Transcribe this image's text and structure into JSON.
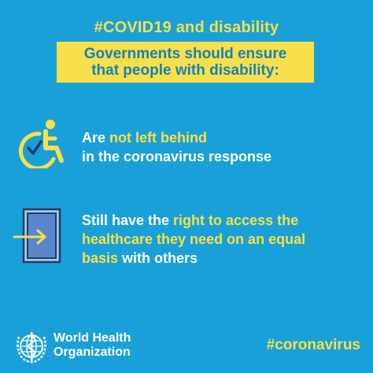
{
  "header": {
    "hashtag": "#COVID19 and disability",
    "banner_line1": "Governments should ensure",
    "banner_line2": "that people with disability:"
  },
  "items": [
    {
      "icon": "wheelchair-check-icon",
      "pre": "Are ",
      "highlight": "not left behind",
      "line2": "in the coronavirus response"
    },
    {
      "icon": "door-arrow-icon",
      "pre": "Still have the ",
      "highlight1": "right to access the",
      "highlight2": "healthcare they need on an equal",
      "highlight3": "basis",
      "post": " with others"
    }
  ],
  "footer": {
    "org_line1": "World Health",
    "org_line2": "Organization",
    "hashtag": "#coronavirus",
    "logo": "who-emblem-icon"
  },
  "colors": {
    "background": "#1aa0d8",
    "accent": "#f7e04b",
    "banner_text": "#1a7fb8",
    "text": "#ffffff"
  }
}
